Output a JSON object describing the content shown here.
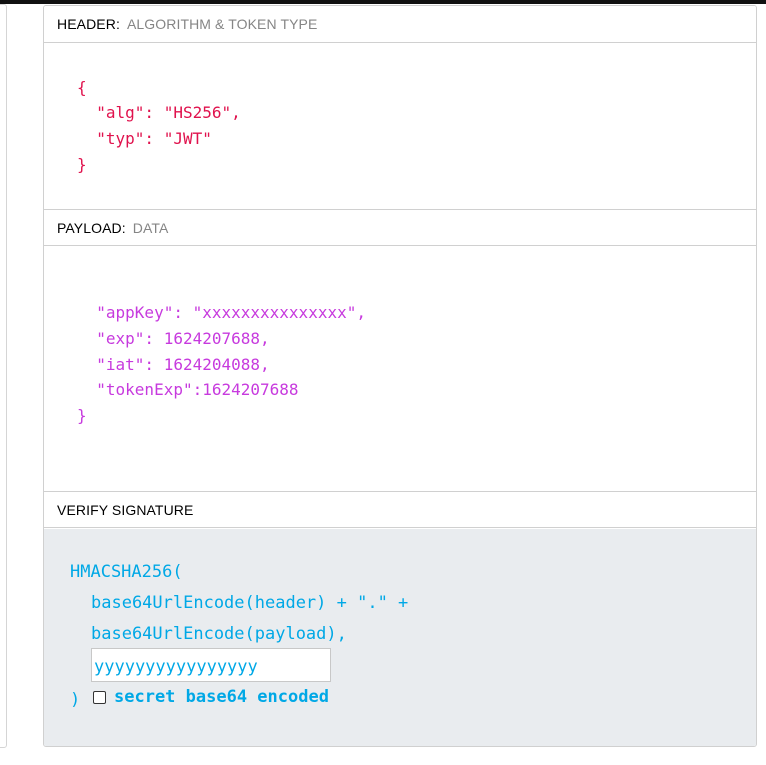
{
  "header_section": {
    "title": "HEADER:",
    "subtitle": "ALGORITHM & TOKEN TYPE",
    "code_lines": [
      "{",
      "  \"alg\": \"HS256\",",
      "  \"typ\": \"JWT\"",
      "}"
    ]
  },
  "payload_section": {
    "title": "PAYLOAD:",
    "subtitle": "DATA",
    "code_lines": [
      "  \"appKey\": \"xxxxxxxxxxxxxxx\",",
      "  \"exp\": 1624207688,",
      "  \"iat\": 1624204088,",
      "  \"tokenExp\":1624207688",
      "}"
    ]
  },
  "verify_section": {
    "title": "VERIFY SIGNATURE",
    "fn_open": "HMACSHA256(",
    "line_header": "base64UrlEncode(header) + \".\" +",
    "line_payload": "base64UrlEncode(payload),",
    "secret_value": "yyyyyyyyyyyyyyyy",
    "close_paren": ")",
    "checkbox_label": "secret base64 encoded",
    "checkbox_checked": false
  },
  "colors": {
    "header_code": "#e0124d",
    "payload_code": "#c73ade",
    "signature_code": "#00a8e6"
  }
}
